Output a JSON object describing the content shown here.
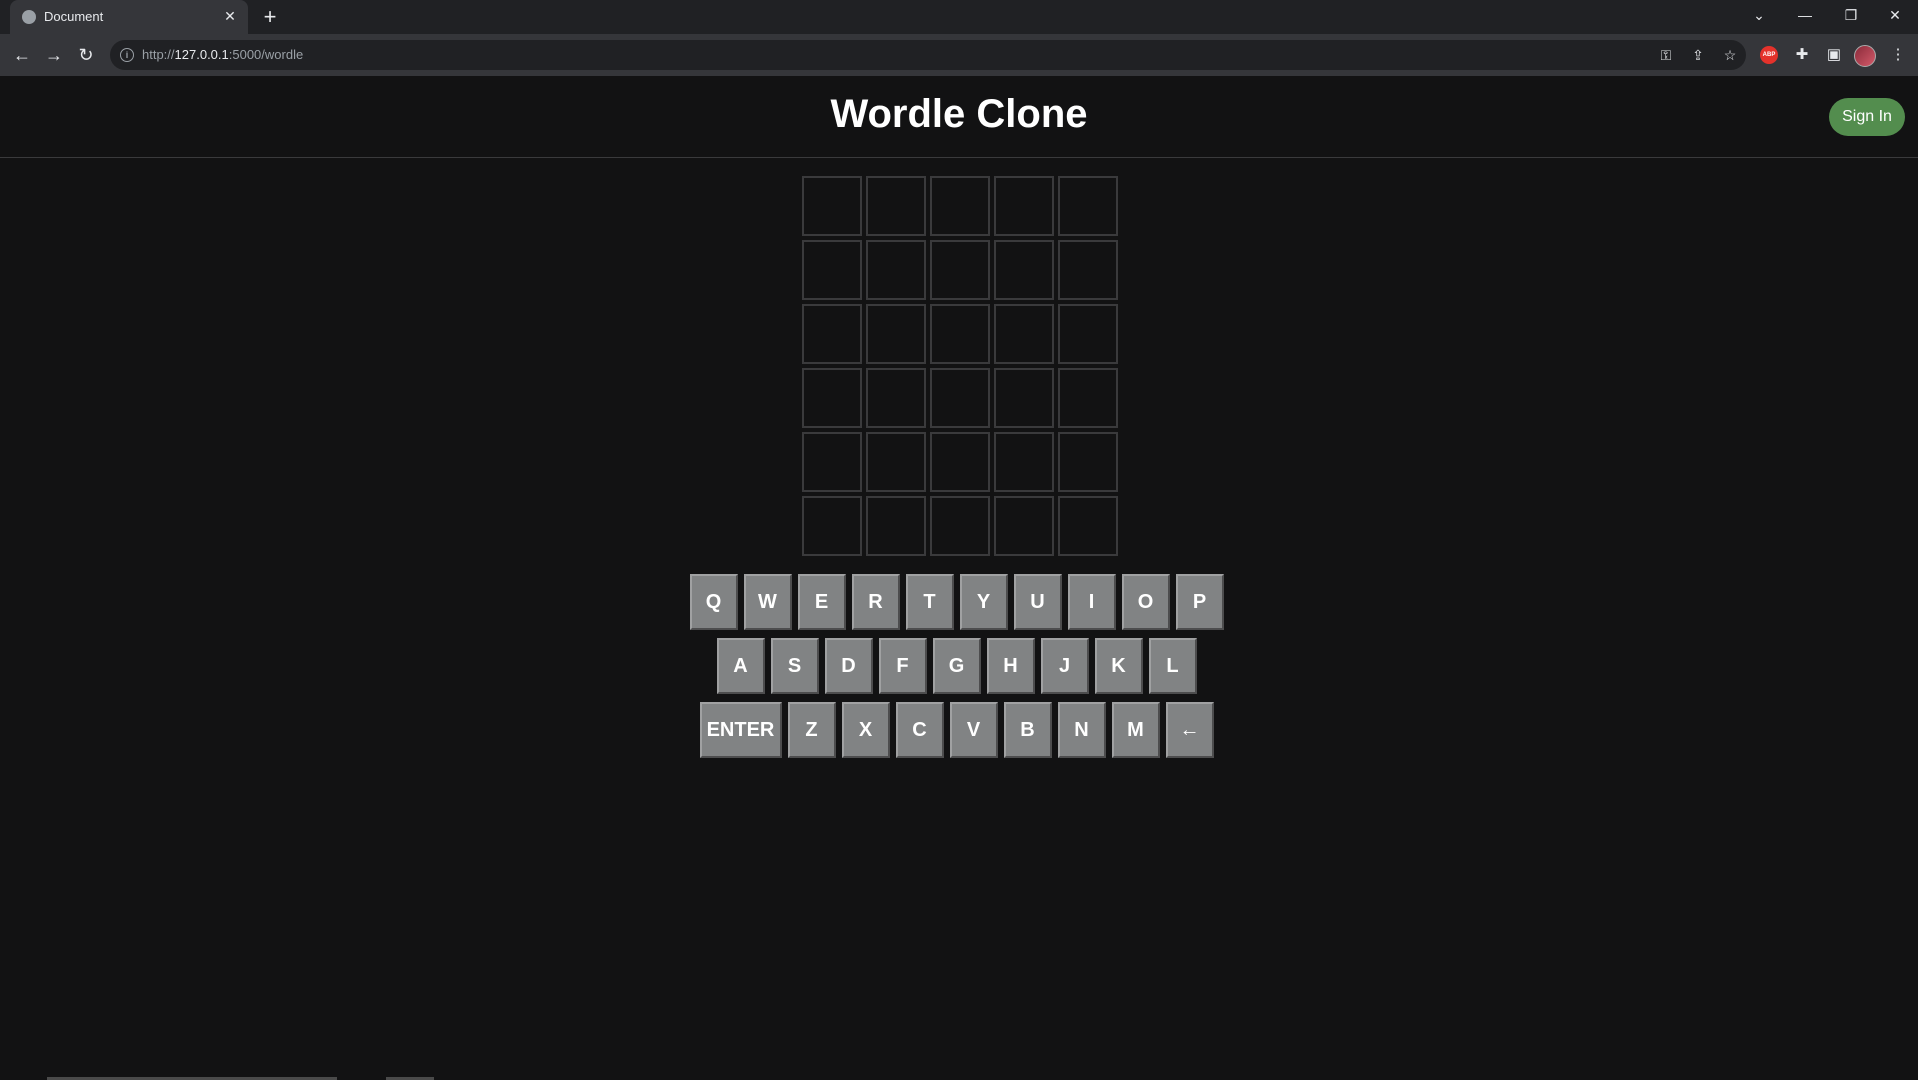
{
  "browser": {
    "tab_title": "Document",
    "tab_close": "✕",
    "new_tab": "+",
    "url_scheme": "http://",
    "url_host": "127.0.0.1",
    "url_rest": ":5000/wordle",
    "info_glyph": "i",
    "icons": {
      "back": "←",
      "forward": "→",
      "reload": "↻",
      "key": "⚿",
      "share": "⇪",
      "star": "☆",
      "puzzle": "✚",
      "sidepanel": "▣",
      "menu": "⋮",
      "abp": "ABP"
    },
    "window": {
      "dropdown": "⌄",
      "minimize": "—",
      "restore": "❐",
      "close": "✕"
    }
  },
  "header": {
    "title": "Wordle Clone",
    "sign_in": "Sign In"
  },
  "board": {
    "rows": 6,
    "cols": 5,
    "letters": []
  },
  "keyboard": {
    "rows": [
      [
        "Q",
        "W",
        "E",
        "R",
        "T",
        "Y",
        "U",
        "I",
        "O",
        "P"
      ],
      [
        "A",
        "S",
        "D",
        "F",
        "G",
        "H",
        "J",
        "K",
        "L"
      ],
      [
        "ENTER",
        "Z",
        "X",
        "C",
        "V",
        "B",
        "N",
        "M",
        "←"
      ]
    ]
  },
  "colors": {
    "background": "#121213",
    "tile_border": "#3a3a3c",
    "key": "#818384",
    "sign_in": "#538d4e"
  }
}
